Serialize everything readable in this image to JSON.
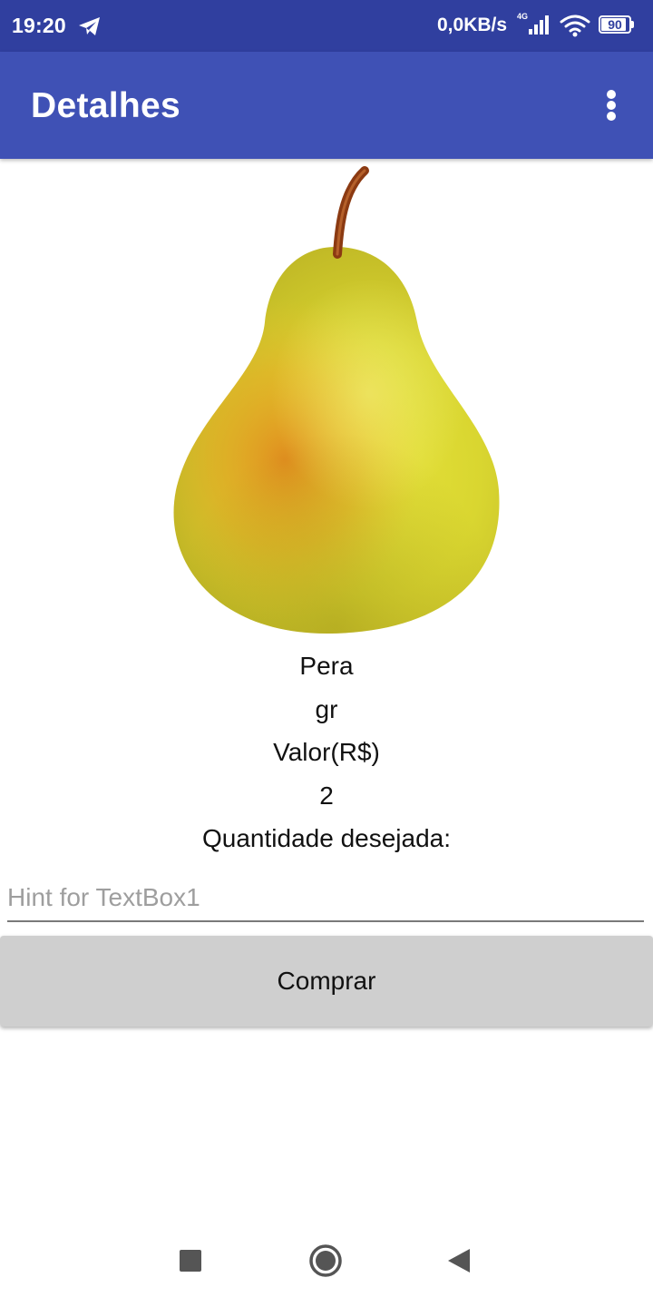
{
  "status_bar": {
    "time": "19:20",
    "net_speed": "0,0KB/s",
    "network_type": "4G",
    "battery_level": 90,
    "battery_text": "90",
    "icons": [
      "telegram-icon",
      "signal-icon",
      "wifi-icon",
      "battery-icon"
    ]
  },
  "app_bar": {
    "title": "Detalhes",
    "overflow_icon": "more-vert-icon"
  },
  "product": {
    "image": "pear-image",
    "name": "Pera",
    "unit": "gr",
    "price_label": "Valor(R$)",
    "price_value": "2",
    "quantity_label": "Quantidade desejada:"
  },
  "quantity_input": {
    "value": "",
    "placeholder": "Hint for TextBox1"
  },
  "buy_button": {
    "label": "Comprar"
  },
  "nav_bar": {
    "icons": [
      "recents-icon",
      "home-icon",
      "back-icon"
    ]
  },
  "colors": {
    "status_bar": "#303f9f",
    "app_bar": "#3f51b5",
    "button": "#cfcfcf",
    "nav_icons": "#555555"
  }
}
